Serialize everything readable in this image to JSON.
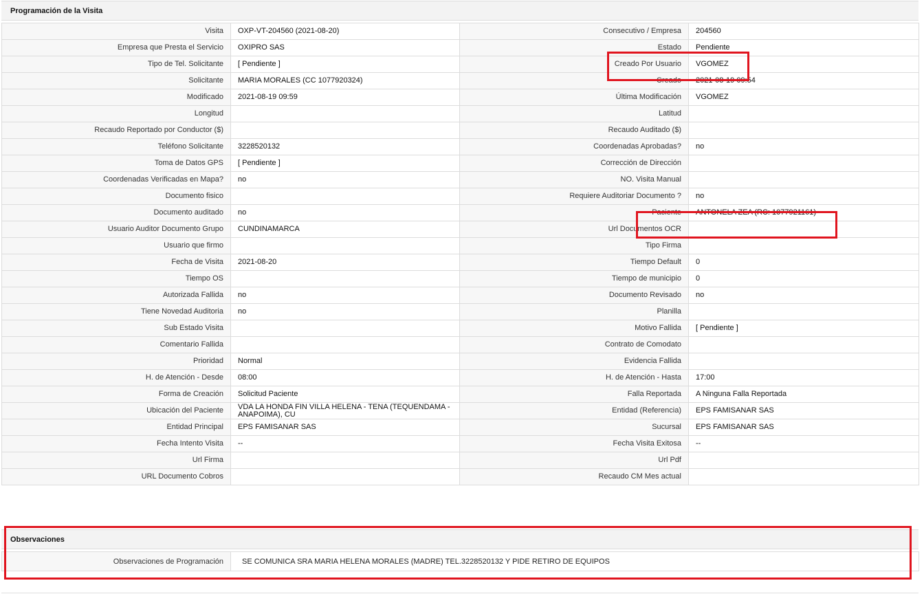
{
  "section_title": "Programación de la Visita",
  "rows": [
    {
      "l1": "Visita",
      "v1": "OXP-VT-204560 (2021-08-20)",
      "l2": "Consecutivo / Empresa",
      "v2": "204560"
    },
    {
      "l1": "Empresa que Presta el Servicio",
      "v1": "OXIPRO SAS",
      "l2": "Estado",
      "v2": "Pendiente"
    },
    {
      "l1": "Tipo de Tel. Solicitante",
      "v1": "[ Pendiente ]",
      "l2": "Creado Por Usuario",
      "v2": "VGOMEZ"
    },
    {
      "l1": "Solicitante",
      "v1": "MARIA MORALES (CC 1077920324)",
      "l2": "Creado",
      "v2": "2021-08-19 09:54"
    },
    {
      "l1": "Modificado",
      "v1": "2021-08-19 09:59",
      "l2": "Última Modificación",
      "v2": " VGOMEZ"
    },
    {
      "l1": "Longitud",
      "v1": "",
      "l2": "Latitud",
      "v2": ""
    },
    {
      "l1": "Recaudo Reportado por Conductor ($)",
      "v1": "",
      "l2": "Recaudo Auditado ($)",
      "v2": ""
    },
    {
      "l1": "Teléfono Solicitante",
      "v1": "3228520132",
      "l2": "Coordenadas Aprobadas?",
      "v2": " no"
    },
    {
      "l1": "Toma de Datos GPS",
      "v1": "[ Pendiente ]",
      "l2": "Corrección de Dirección",
      "v2": ""
    },
    {
      "l1": "Coordenadas Verificadas en Mapa?",
      "v1": " no",
      "l2": "NO. Visita Manual",
      "v2": ""
    },
    {
      "l1": "Documento fisico",
      "v1": "",
      "l2": "Requiere Auditoriar Documento ?",
      "v2": " no"
    },
    {
      "l1": "Documento auditado",
      "v1": " no",
      "l2": "Paciente",
      "v2": "ANTONELA ZEA (RC: 1077921161)"
    },
    {
      "l1": "Usuario Auditor Documento Grupo",
      "v1": "CUNDINAMARCA",
      "l2": "Url Documentos OCR",
      "v2": ""
    },
    {
      "l1": "Usuario que firmo",
      "v1": "",
      "l2": "Tipo Firma",
      "v2": ""
    },
    {
      "l1": "Fecha de Visita",
      "v1": " 2021-08-20",
      "l2": "Tiempo Default",
      "v2": " 0"
    },
    {
      "l1": "Tiempo OS",
      "v1": "",
      "l2": "Tiempo de municipio",
      "v2": " 0"
    },
    {
      "l1": "Autorizada Fallida",
      "v1": " no",
      "l2": "Documento Revisado",
      "v2": " no"
    },
    {
      "l1": "Tiene Novedad Auditoria",
      "v1": " no",
      "l2": "Planilla",
      "v2": ""
    },
    {
      "l1": "Sub Estado Visita",
      "v1": "",
      "l2": "Motivo Fallida",
      "v2": "[ Pendiente ]"
    },
    {
      "l1": "Comentario Fallida",
      "v1": "",
      "l2": "Contrato de Comodato",
      "v2": ""
    },
    {
      "l1": "Prioridad",
      "v1": "Normal",
      "l2": "Evidencia Fallida",
      "v2": ""
    },
    {
      "l1": "H. de Atención - Desde",
      "v1": "08:00",
      "l2": "H. de Atención - Hasta",
      "v2": "17:00"
    },
    {
      "l1": "Forma de Creación",
      "v1": "Solicitud Paciente",
      "l2": "Falla Reportada",
      "v2": "A Ninguna Falla Reportada"
    },
    {
      "l1": "Ubicación del Paciente",
      "v1": "VDA LA HONDA FIN VILLA HELENA - TENA (TEQUENDAMA - ANAPOIMA), CU",
      "l2": "Entidad (Referencia)",
      "v2": "EPS FAMISANAR SAS"
    },
    {
      "l1": "Entidad Principal",
      "v1": "EPS FAMISANAR SAS",
      "l2": "Sucursal",
      "v2": "EPS FAMISANAR SAS"
    },
    {
      "l1": "Fecha Intento Visita",
      "v1": " --",
      "l2": "Fecha Visita Exitosa",
      "v2": " --"
    },
    {
      "l1": "Url Firma",
      "v1": "",
      "l2": "Url Pdf",
      "v2": ""
    },
    {
      "l1": "URL Documento Cobros",
      "v1": "",
      "l2": "Recaudo CM Mes actual",
      "v2": ""
    }
  ],
  "observaciones": {
    "title": "Observaciones",
    "label": "Observaciones de Programación",
    "value": "SE COMUNICA SRA MARIA HELENA MORALES (MADRE) TEL.3228520132 Y PIDE RETIRO DE EQUIPOS"
  },
  "highlight_color": "#e0141e"
}
